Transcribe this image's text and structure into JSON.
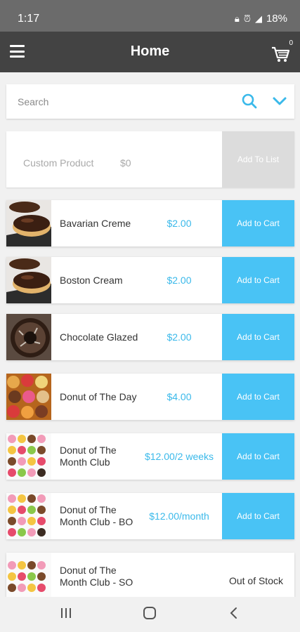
{
  "status_bar": {
    "time": "1:17",
    "battery": "18%"
  },
  "app_bar": {
    "title": "Home",
    "cart_count": "0"
  },
  "search": {
    "placeholder": "Search"
  },
  "custom_product": {
    "name": "Custom Product",
    "price": "$0",
    "button": "Add To List"
  },
  "products": [
    {
      "name": "Bavarian Creme",
      "price": "$2.00",
      "action": "Add to Cart",
      "image": "chocolate-donut"
    },
    {
      "name": "Boston Cream",
      "price": "$2.00",
      "action": "Add to Cart",
      "image": "chocolate-donut"
    },
    {
      "name": "Chocolate Glazed",
      "price": "$2.00",
      "action": "Add to Cart",
      "image": "glazed-donut"
    },
    {
      "name": "Donut of The Day",
      "price": "$4.00",
      "action": "Add to Cart",
      "image": "donut-box"
    },
    {
      "name": "Donut of The Month Club",
      "price": "$12.00/2 weeks",
      "action": "Add to Cart",
      "image": "donut-grid"
    },
    {
      "name": "Donut of The Month Club - BO",
      "price": "$12.00/month",
      "action": "Add to Cart",
      "image": "donut-grid"
    },
    {
      "name": "Donut of The Month Club - SO",
      "price": "",
      "action": "",
      "status": "Out of Stock",
      "image": "donut-grid"
    }
  ],
  "colors": {
    "accent": "#49c3f5",
    "price": "#3ab9ea",
    "appbar": "#434343",
    "statusbar": "#6b6b6b"
  }
}
